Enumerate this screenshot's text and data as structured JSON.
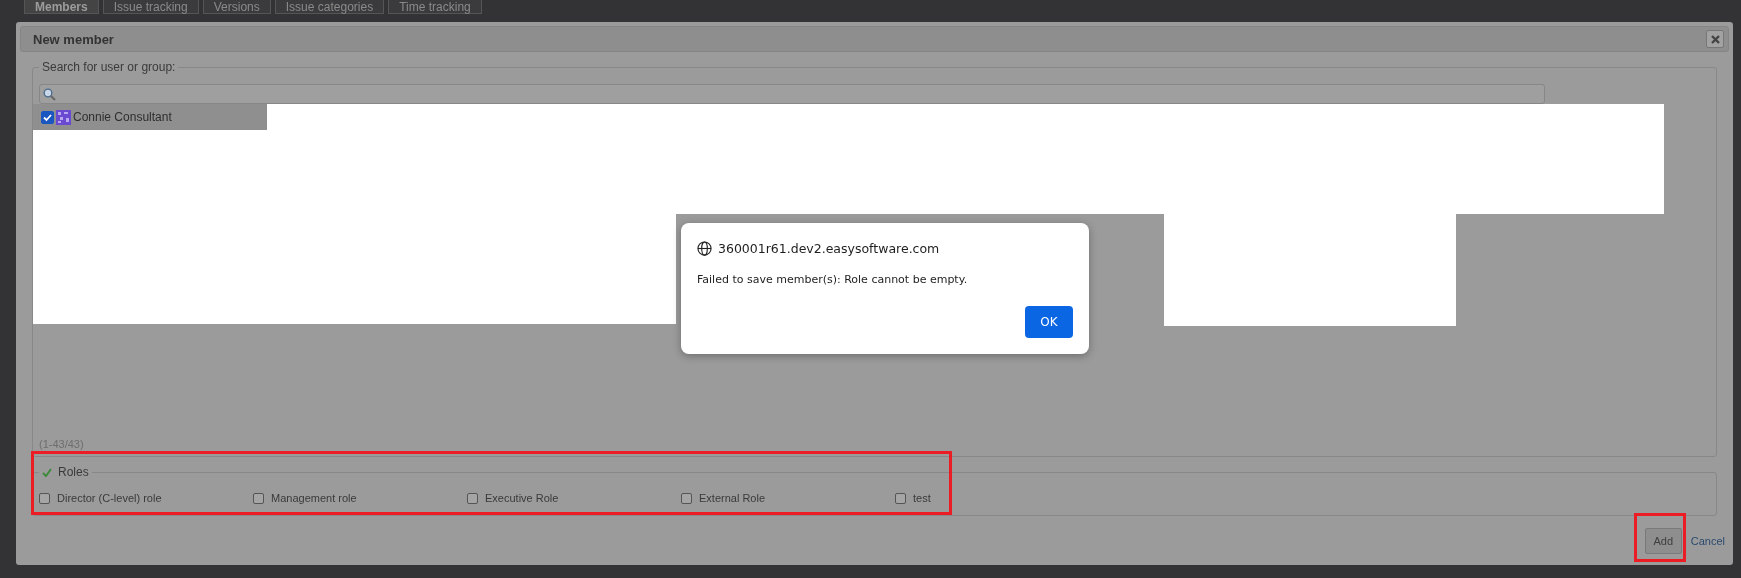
{
  "tabs": [
    {
      "label": "Members",
      "selected": true
    },
    {
      "label": "Issue tracking",
      "selected": false
    },
    {
      "label": "Versions",
      "selected": false
    },
    {
      "label": "Issue categories",
      "selected": false
    },
    {
      "label": "Time tracking",
      "selected": false
    }
  ],
  "dialog": {
    "title": "New member",
    "search": {
      "legend": "Search for user or group:"
    },
    "results": [
      {
        "name": "Connie Consultant",
        "checked": true
      }
    ],
    "count": "(1-43/43)",
    "roles": {
      "legend": "Roles",
      "items": [
        {
          "label": "Director (C-level) role",
          "checked": false
        },
        {
          "label": "Management role",
          "checked": false
        },
        {
          "label": "Executive Role",
          "checked": false
        },
        {
          "label": "External Role",
          "checked": false
        },
        {
          "label": "test",
          "checked": false
        }
      ]
    },
    "add": "Add",
    "cancel": "Cancel"
  },
  "alert": {
    "origin": "360001r61.dev2.easysoftware.com",
    "message": "Failed to save member(s): Role cannot be empty.",
    "button": "OK"
  }
}
